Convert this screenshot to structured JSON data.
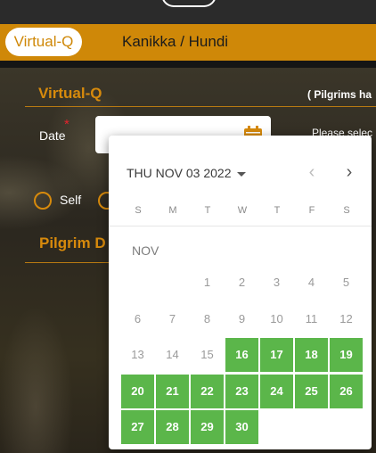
{
  "nav": {
    "active_label": "Virtual-Q",
    "item_label": "Kanikka / Hundi"
  },
  "form": {
    "section_title": "Virtual-Q",
    "pilgrim_note": "( Pilgrims ha",
    "date_label": "Date",
    "required_mark": "*",
    "select_note": "Please selec",
    "self_label": "Self",
    "pilgrim_section_title": "Pilgrim D"
  },
  "datepicker": {
    "header": "THU NOV 03 2022",
    "prev_glyph": "‹",
    "next_glyph": "›",
    "weekdays": [
      "S",
      "M",
      "T",
      "W",
      "T",
      "F",
      "S"
    ],
    "month_label": "NOV",
    "days": [
      {
        "label": "1",
        "col": 2,
        "row": 0,
        "available": false
      },
      {
        "label": "2",
        "col": 3,
        "row": 0,
        "available": false
      },
      {
        "label": "3",
        "col": 4,
        "row": 0,
        "available": false
      },
      {
        "label": "4",
        "col": 5,
        "row": 0,
        "available": false
      },
      {
        "label": "5",
        "col": 6,
        "row": 0,
        "available": false
      },
      {
        "label": "6",
        "col": 0,
        "row": 1,
        "available": false
      },
      {
        "label": "7",
        "col": 1,
        "row": 1,
        "available": false
      },
      {
        "label": "8",
        "col": 2,
        "row": 1,
        "available": false
      },
      {
        "label": "9",
        "col": 3,
        "row": 1,
        "available": false
      },
      {
        "label": "10",
        "col": 4,
        "row": 1,
        "available": false
      },
      {
        "label": "11",
        "col": 5,
        "row": 1,
        "available": false
      },
      {
        "label": "12",
        "col": 6,
        "row": 1,
        "available": false
      },
      {
        "label": "13",
        "col": 0,
        "row": 2,
        "available": false
      },
      {
        "label": "14",
        "col": 1,
        "row": 2,
        "available": false
      },
      {
        "label": "15",
        "col": 2,
        "row": 2,
        "available": false
      },
      {
        "label": "16",
        "col": 3,
        "row": 2,
        "available": true
      },
      {
        "label": "17",
        "col": 4,
        "row": 2,
        "available": true
      },
      {
        "label": "18",
        "col": 5,
        "row": 2,
        "available": true
      },
      {
        "label": "19",
        "col": 6,
        "row": 2,
        "available": true
      },
      {
        "label": "20",
        "col": 0,
        "row": 3,
        "available": true
      },
      {
        "label": "21",
        "col": 1,
        "row": 3,
        "available": true
      },
      {
        "label": "22",
        "col": 2,
        "row": 3,
        "available": true
      },
      {
        "label": "23",
        "col": 3,
        "row": 3,
        "available": true
      },
      {
        "label": "24",
        "col": 4,
        "row": 3,
        "available": true
      },
      {
        "label": "25",
        "col": 5,
        "row": 3,
        "available": true
      },
      {
        "label": "26",
        "col": 6,
        "row": 3,
        "available": true
      },
      {
        "label": "27",
        "col": 0,
        "row": 4,
        "available": true
      },
      {
        "label": "28",
        "col": 1,
        "row": 4,
        "available": true
      },
      {
        "label": "29",
        "col": 2,
        "row": 4,
        "available": true
      },
      {
        "label": "30",
        "col": 3,
        "row": 4,
        "available": true
      }
    ]
  },
  "colors": {
    "accent_orange": "#cf8808",
    "available_green": "#5bb64a",
    "required_red": "#e4222c"
  }
}
